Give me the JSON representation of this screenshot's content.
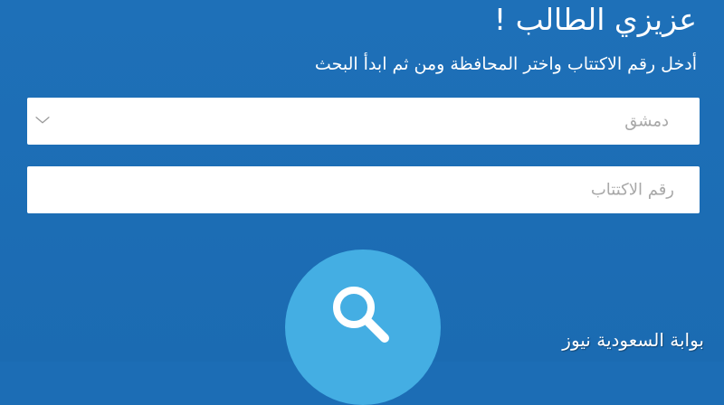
{
  "header": {
    "greeting": "عزيزي الطالب !",
    "instruction": "أدخل رقم الاكتتاب واختر المحافظة ومن ثم ابدأ البحث"
  },
  "form": {
    "governorate": {
      "selected": "دمشق",
      "icon": "chevron-down-icon"
    },
    "exam_number": {
      "placeholder": "رقم الاكتتاب"
    },
    "search_button": {
      "icon": "search-icon"
    }
  },
  "watermark": "بوابة السعودية نيوز",
  "colors": {
    "background": "#1c6db5",
    "field": "#ffffff",
    "placeholder": "#a8a8a8",
    "search_button": "#44aee3"
  }
}
